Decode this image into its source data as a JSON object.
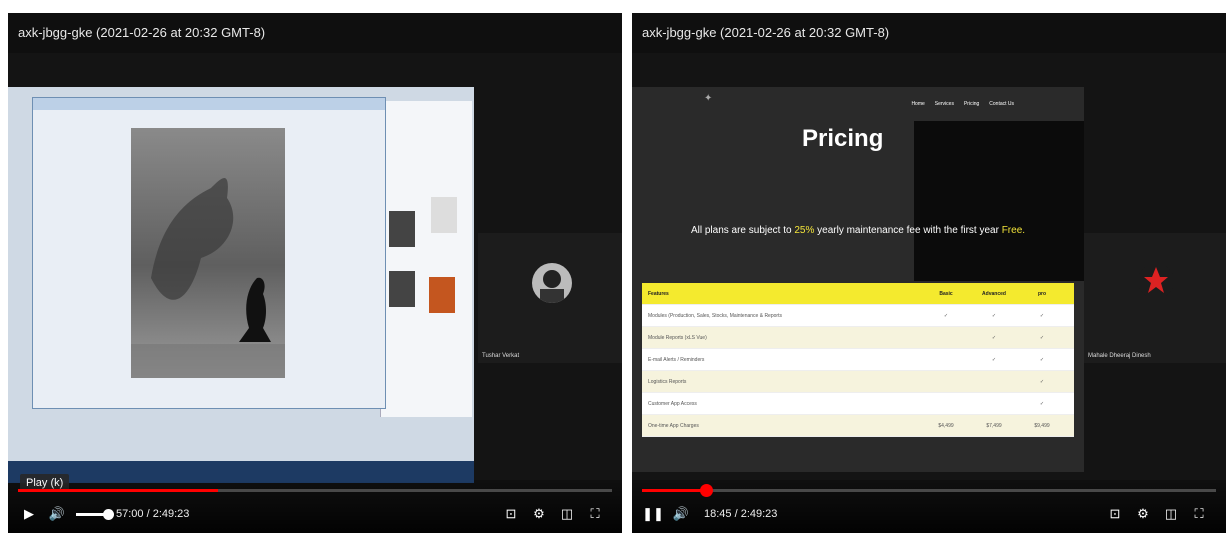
{
  "players": [
    {
      "title": "axk-jbgg-gke (2021-02-26 at 20:32 GMT-8)",
      "time": "57:00 / 2:49:23",
      "progress_fraction": 0.337,
      "tooltip": "Play (k)",
      "state": "paused",
      "participant": {
        "name": "Tushar Verkat"
      }
    },
    {
      "title": "axk-jbgg-gke (2021-02-26 at 20:32 GMT-8)",
      "time": "18:45 / 2:49:23",
      "progress_fraction": 0.111,
      "state": "playing",
      "participant": {
        "name": "Mahale Dheeraj Dinesh"
      }
    }
  ],
  "site": {
    "nav": [
      "Home",
      "Services",
      "Pricing",
      "Contact Us"
    ],
    "heading": "Pricing",
    "note_pre": "All plans are subject to ",
    "note_pct": "25%",
    "note_mid": " yearly maintenance fee with the first year ",
    "note_free": "Free.",
    "table": {
      "header": [
        "Features",
        "Basic",
        "Advanced",
        "pro"
      ],
      "rows": [
        [
          "Modules (Production, Sales, Stocks, Maintenance & Reports",
          "✓",
          "✓",
          "✓"
        ],
        [
          "Module Reports (xLS Vue)",
          "",
          "✓",
          "✓"
        ],
        [
          "E-mail Alerts / Reminders",
          "",
          "✓",
          "✓"
        ],
        [
          "Logistics Reports",
          "",
          "",
          "✓"
        ],
        [
          "Customer App Access",
          "",
          "",
          "✓"
        ],
        [
          "One-time App Charges",
          "$4,499",
          "$7,499",
          "$9,499"
        ]
      ]
    }
  },
  "colors": {
    "accent": "#ff0000",
    "highlight": "#f4ea2e"
  },
  "icons": [
    "play-icon",
    "pause-icon",
    "volume-icon",
    "subtitles-icon",
    "settings-icon",
    "miniplayer-icon",
    "fullscreen-icon"
  ]
}
